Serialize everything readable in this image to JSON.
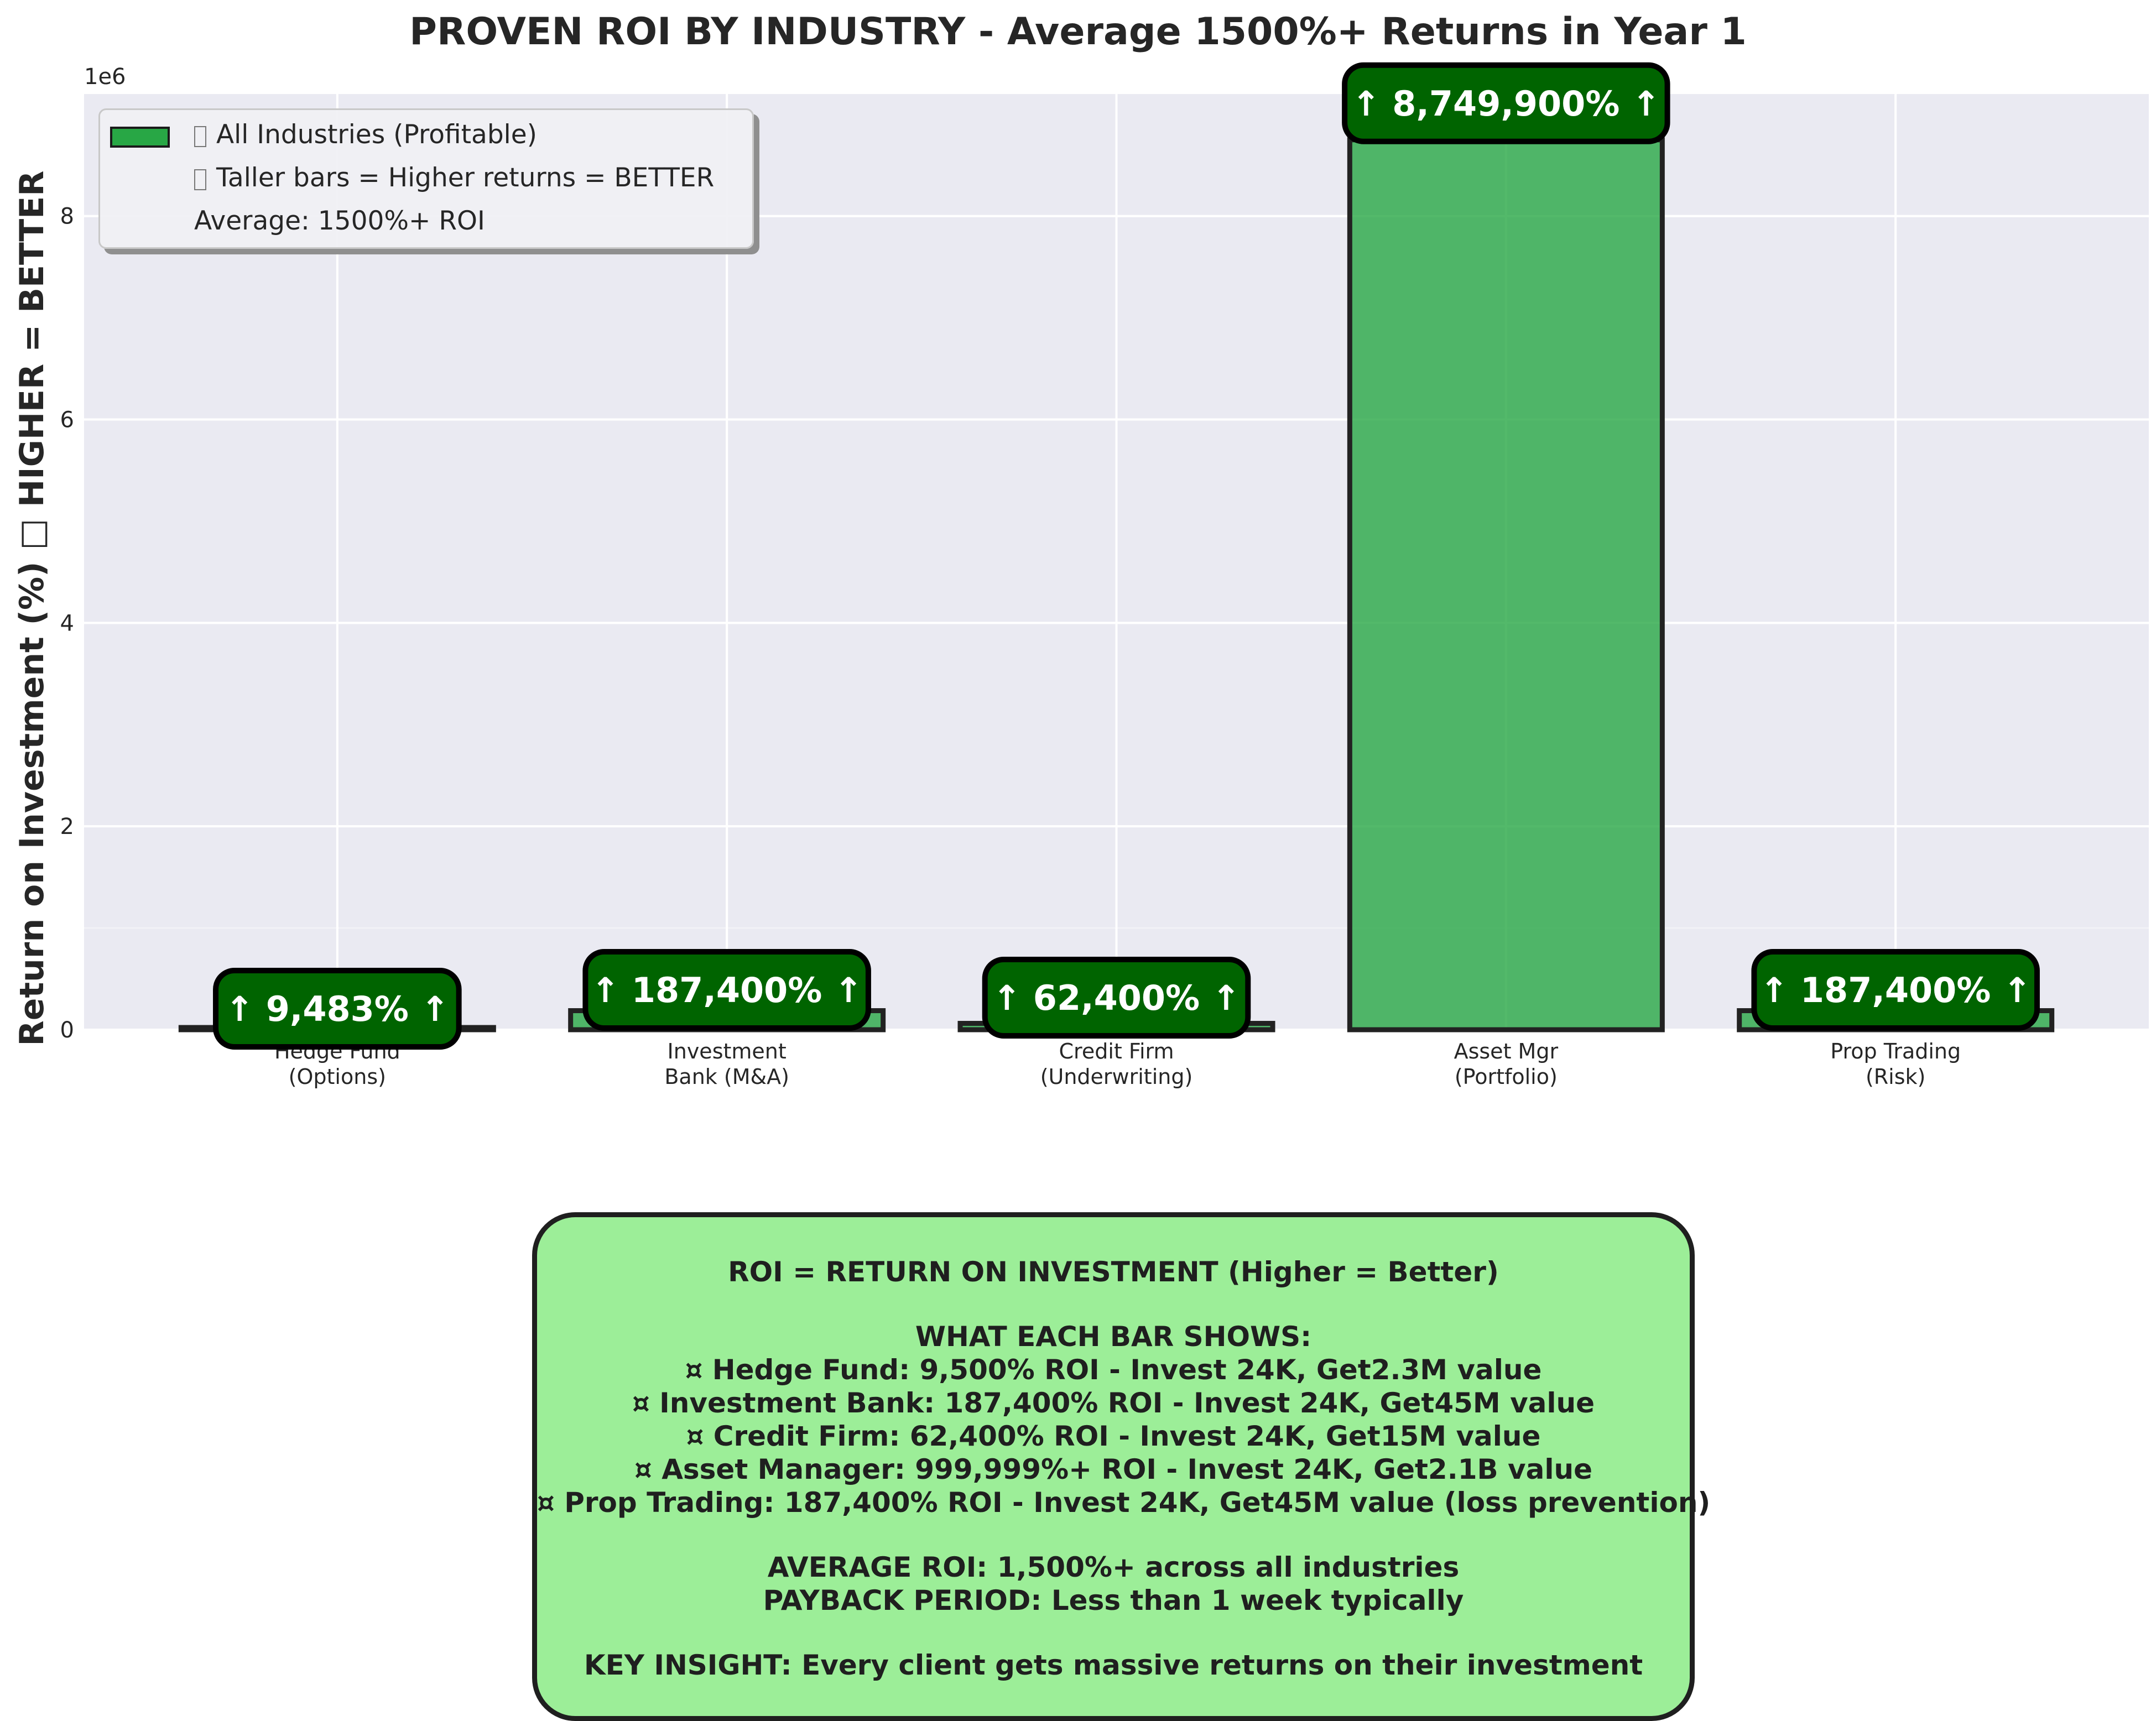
{
  "chart_data": {
    "type": "bar",
    "title": "PROVEN ROI BY INDUSTRY - Average 1500%+ Returns in Year 1",
    "ylabel": "Return on Investment (%) □ HIGHER = BETTER",
    "xlabel": "",
    "y_scale_label": "1e6",
    "ylim": [
      0,
      9.2
    ],
    "y_ticks": [
      0,
      2,
      4,
      6,
      8
    ],
    "categories": [
      "Hedge Fund\n(Options)",
      "Investment\nBank (M&A)",
      "Credit Firm\n(Underwriting)",
      "Asset Mgr\n(Portfolio)",
      "Prop Trading\n(Risk)"
    ],
    "values": [
      9483,
      187400,
      62400,
      8749900,
      187400
    ],
    "data_labels": [
      "↑ 9,483% ↑",
      "↑ 187,400% ↑",
      "↑ 62,400% ↑",
      "↑ 8,749,900% ↑",
      "↑ 187,400% ↑"
    ],
    "bar_color": "#28a745",
    "label_box_color": "#006400",
    "grid": true,
    "legend_position": "top-left",
    "legend": [
      {
        "text": "All Industries (Profitable)",
        "has_swatch": true,
        "has_glyph": true
      },
      {
        "text": "Taller bars = Higher returns = BETTER",
        "has_swatch": false,
        "has_glyph": true
      },
      {
        "text": "Average: 1500%+ ROI",
        "has_swatch": false,
        "has_glyph": false
      }
    ]
  },
  "info_box": {
    "lines": [
      "ROI = RETURN ON INVESTMENT (Higher = Better)",
      "",
      "WHAT EACH BAR SHOWS:",
      "¤ Hedge Fund: 9,500% ROI - Invest 24K, Get2.3M value",
      "¤ Investment Bank: 187,400% ROI - Invest 24K, Get45M value",
      "¤ Credit Firm: 62,400% ROI - Invest 24K, Get15M value",
      "¤ Asset Manager: 999,999%+ ROI - Invest 24K, Get2.1B value",
      "¤ Prop Trading: 187,400% ROI - Invest 24K, Get45M value (loss prevention)",
      "",
      "AVERAGE ROI: 1,500%+ across all industries",
      "PAYBACK PERIOD: Less than 1 week typically",
      "",
      "KEY INSIGHT: Every client gets massive returns on their investment"
    ]
  }
}
